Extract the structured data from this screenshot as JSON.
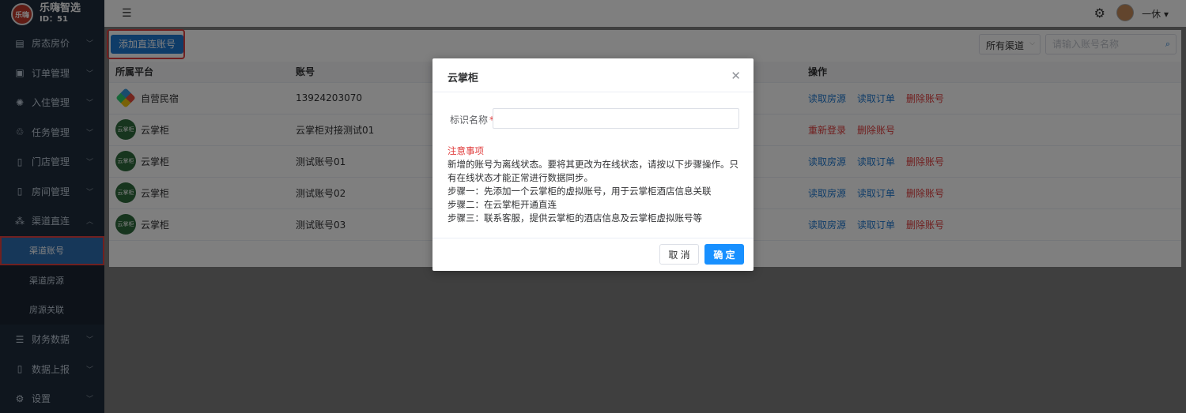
{
  "brand": {
    "name": "乐嗨智选",
    "id": "ID：51",
    "logo_text": "乐嗨"
  },
  "menu": [
    {
      "label": "房态房价",
      "icon": "building-icon"
    },
    {
      "label": "订单管理",
      "icon": "order-icon"
    },
    {
      "label": "入住管理",
      "icon": "checkin-icon"
    },
    {
      "label": "任务管理",
      "icon": "task-icon"
    },
    {
      "label": "门店管理",
      "icon": "store-icon"
    },
    {
      "label": "房间管理",
      "icon": "room-icon"
    },
    {
      "label": "渠道直连",
      "icon": "channel-icon"
    }
  ],
  "submenu": [
    {
      "label": "渠道账号"
    },
    {
      "label": "渠道房源"
    },
    {
      "label": "房源关联"
    }
  ],
  "menu_bottom": [
    {
      "label": "财务数据",
      "icon": "finance-icon"
    },
    {
      "label": "数据上报",
      "icon": "report-icon"
    },
    {
      "label": "设置",
      "icon": "gear-icon"
    }
  ],
  "header": {
    "username": "一休"
  },
  "toolbar": {
    "add_label": "添加直连账号",
    "channel_select": "所有渠道",
    "search_placeholder": "请输入账号名称"
  },
  "table": {
    "columns": [
      "所属平台",
      "账号",
      "操作"
    ],
    "rows": [
      {
        "platform": "自营民宿",
        "logo": "self",
        "account": "13924203070",
        "ops": [
          {
            "label": "读取房源",
            "color": "blue"
          },
          {
            "label": "读取订单",
            "color": "blue"
          },
          {
            "label": "删除账号",
            "color": "red"
          }
        ]
      },
      {
        "platform": "云掌柜",
        "logo": "yzg",
        "account": "云掌柜对接测试01",
        "ops": [
          {
            "label": "重新登录",
            "color": "red"
          },
          {
            "label": "删除账号",
            "color": "red"
          }
        ]
      },
      {
        "platform": "云掌柜",
        "logo": "yzg",
        "account": "测试账号01",
        "ops": [
          {
            "label": "读取房源",
            "color": "blue"
          },
          {
            "label": "读取订单",
            "color": "blue"
          },
          {
            "label": "删除账号",
            "color": "red"
          }
        ]
      },
      {
        "platform": "云掌柜",
        "logo": "yzg",
        "account": "测试账号02",
        "ops": [
          {
            "label": "读取房源",
            "color": "blue"
          },
          {
            "label": "读取订单",
            "color": "blue"
          },
          {
            "label": "删除账号",
            "color": "red"
          }
        ]
      },
      {
        "platform": "云掌柜",
        "logo": "yzg",
        "account": "测试账号03",
        "ops": [
          {
            "label": "读取房源",
            "color": "blue"
          },
          {
            "label": "读取订单",
            "color": "blue"
          },
          {
            "label": "删除账号",
            "color": "red"
          }
        ]
      }
    ]
  },
  "modal": {
    "title": "云掌柜",
    "field_label": "标识名称",
    "field_required": "*",
    "field_value": "",
    "notice_title": "注意事项",
    "notice_lines": [
      "新增的账号为离线状态。要将其更改为在线状态，请按以下步骤操作。只有在线状态才能正常进行数据同步。",
      "步骤一：先添加一个云掌柜的虚拟账号，用于云掌柜酒店信息关联",
      "步骤二：在云掌柜开通直连",
      "步骤三：联系客服，提供云掌柜的酒店信息及云掌柜虚拟账号等"
    ],
    "cancel_label": "取 消",
    "ok_label": "确 定"
  },
  "colors": {
    "primary": "#1f78d1",
    "danger": "#e03c3c",
    "sidebar": "#1f2d3d"
  }
}
